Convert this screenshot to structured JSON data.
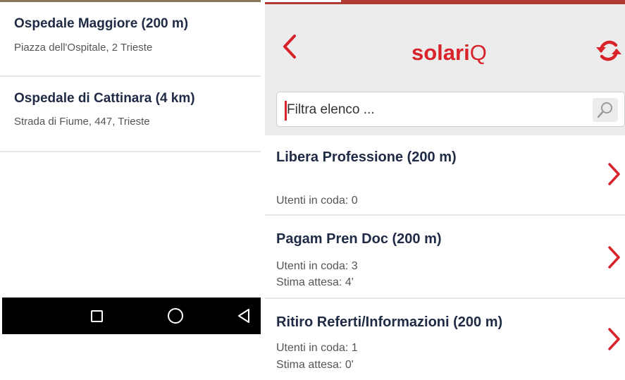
{
  "left_screen": {
    "hospitals": [
      {
        "name": "Ospedale Maggiore (200 m)",
        "address": "Piazza dell'Ospitale, 2 Trieste"
      },
      {
        "name": "Ospedale di Cattinara (4 km)",
        "address": "Strada di Fiume, 447, Trieste"
      }
    ],
    "nav_bar": {
      "icons": [
        "recent-apps-icon",
        "home-icon",
        "back-triangle-icon"
      ]
    }
  },
  "right_screen": {
    "header": {
      "logo_bold": "solari",
      "logo_thin": "Q",
      "back_icon": "chevron-left-icon",
      "refresh_icon": "refresh-icon"
    },
    "search": {
      "placeholder": "Filtra elenco ...",
      "icon": "search-icon"
    },
    "queues": [
      {
        "title": "Libera Professione (200 m)",
        "users": "Utenti in coda: 0"
      },
      {
        "title": "Pagam Pren Doc (200 m)",
        "users": "Utenti in coda: 3",
        "wait": "Stima attesa: 4'"
      },
      {
        "title": "Ritiro Referti/Informazioni (200 m)",
        "users": "Utenti in coda: 1",
        "wait": "Stima attesa: 0'"
      }
    ]
  },
  "colors": {
    "accent": "#d8232a",
    "title_text": "#1f2a44",
    "secondary_text": "#555555",
    "header_bg": "#ececec",
    "nav_bar_bg": "#000000"
  }
}
